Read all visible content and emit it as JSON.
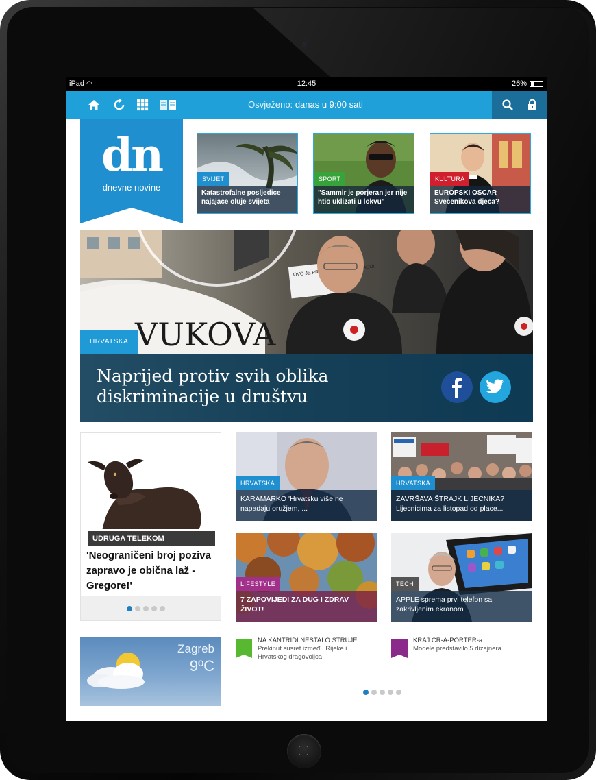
{
  "status_bar": {
    "device": "iPad",
    "time": "12:45",
    "battery": "26%",
    "battery_level": 0.26
  },
  "toolbar": {
    "refreshed_label": "Osvježeno:",
    "refreshed_value": "danas u 9:00 sati",
    "colors": {
      "bar": "#1fa0d8",
      "dark": "#1a6e99"
    },
    "icons": [
      "home-icon",
      "refresh-icon",
      "grid-icon",
      "book-icon",
      "search-icon",
      "lock-icon"
    ]
  },
  "logo": {
    "word": "dn",
    "name": "dnevne novine",
    "color": "#1f8fd0"
  },
  "top_tiles": [
    {
      "tag": "SVIJET",
      "tag_color": "#1f8fd0",
      "caption": "Katastrofalne posljedice najajace oluje svijeta"
    },
    {
      "tag": "SPORT",
      "tag_color": "#38a33a",
      "caption": "\"Sammir je porjeran jer nije htio uklizati u lokvu\""
    },
    {
      "tag": "KULTURA",
      "tag_color": "#d0202e",
      "caption": "EUROPSKI OSCAR Svecenikova djeca?"
    }
  ],
  "hero": {
    "tag": "HRVATSKA",
    "headline": "Naprijed protiv svih oblika diskriminacije u društvu",
    "sign_text": "VUKOVA",
    "placard": "OVO JE PRVI KORAK KA USTRACIJI",
    "social": [
      "facebook-icon",
      "twitter-icon"
    ]
  },
  "left_card": {
    "tag": "UDRUGA TELEKOM",
    "title": "'Neograničeni broj poziva zapravo je obična laž - Gregore!'",
    "pager": {
      "count": 5,
      "active": 0
    }
  },
  "tiles": [
    {
      "tag": "HRVATSKA",
      "tag_color": "#1f8fd0",
      "caption": "KARAMARKO 'Hrvatsku više ne napadaju oružjem, ..."
    },
    {
      "tag": "HRVATSKA",
      "tag_color": "#1f8fd0",
      "caption": "ZAVRŠAVA ŠTRAJK LIJECNIKA? Lijecnicima za listopad od place..."
    },
    {
      "tag": "LIFESTYLE",
      "tag_color": "#a0308a",
      "caption": "7 ZAPOVIJEDI ZA DUG I ZDRAV ŽIVOT!"
    },
    {
      "tag": "TECH",
      "tag_color": "#555555",
      "caption": "APPLE sprema prvi telefon sa zakrivljenim ekranom"
    }
  ],
  "weather": {
    "city": "Zagreb",
    "temp": "9ºC"
  },
  "briefs": [
    {
      "color": "#58b830",
      "heading": "NA KANTRIDI NESTALO STRUJE",
      "text": "Prekinut susret između Rijeke i Hrvatskog dragovoljca"
    },
    {
      "color": "#8a2a8a",
      "heading": "KRAJ CR-A-PORTER-a",
      "text": "Modele predstavilo 5 dizajnera"
    }
  ],
  "bottom_pager": {
    "count": 5,
    "active": 0
  }
}
